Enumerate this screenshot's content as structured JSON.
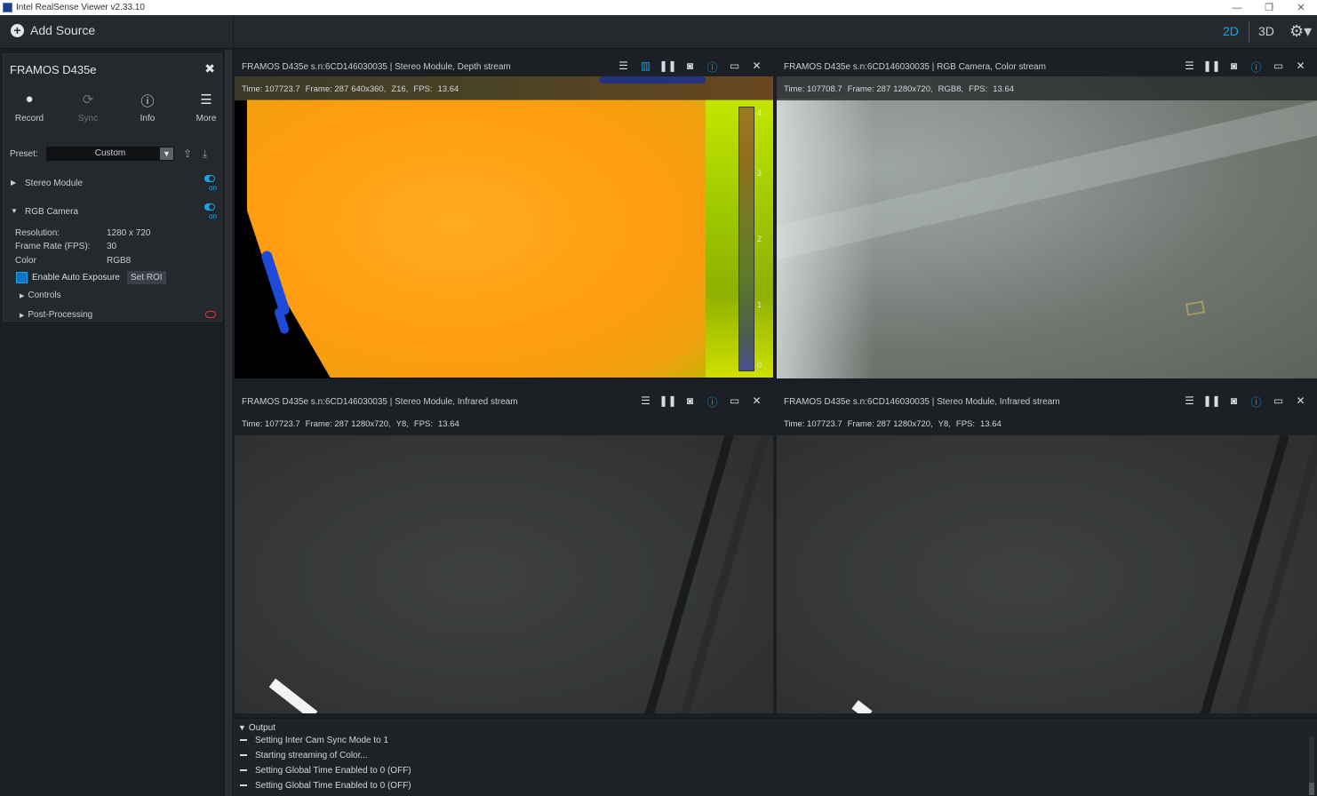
{
  "window": {
    "title": "Intel RealSense Viewer v2.33.10",
    "controls": [
      "—",
      "❐",
      "✕"
    ]
  },
  "topbar": {
    "add_source": "Add Source",
    "view_2d": "2D",
    "view_3d": "3D",
    "settings_icon": "gear-icon"
  },
  "device": {
    "name": "FRAMOS D435e",
    "tools": [
      {
        "label": "Record",
        "icon": "record-icon",
        "enabled": true
      },
      {
        "label": "Sync",
        "icon": "sync-icon",
        "enabled": false
      },
      {
        "label": "Info",
        "icon": "info-icon",
        "enabled": true
      },
      {
        "label": "More",
        "icon": "menu-icon",
        "enabled": true
      }
    ],
    "preset_label": "Preset:",
    "preset_value": "Custom",
    "sensors": [
      {
        "name": "Stereo Module",
        "state": "on",
        "expanded": false
      },
      {
        "name": "RGB Camera",
        "state": "on",
        "expanded": true
      }
    ],
    "rgb_props": [
      {
        "key": "Resolution:",
        "value": "1280 x 720"
      },
      {
        "key": "Frame Rate (FPS):",
        "value": "30"
      },
      {
        "key": "Color",
        "value": "RGB8"
      }
    ],
    "auto_exposure_label": "Enable Auto Exposure",
    "set_roi": "Set ROI",
    "controls": "Controls",
    "post_processing": "Post-Processing"
  },
  "streams": [
    {
      "title": "FRAMOS D435e s.n:6CD146030035 | Stereo Module, Depth stream",
      "time": "Time: 107723.7",
      "frame": "Frame: 287",
      "res": "640x360,",
      "fmt": "Z16,",
      "fps": "FPS:",
      "fps_val": "13.64"
    },
    {
      "title": "FRAMOS D435e s.n:6CD146030035 | RGB Camera, Color stream",
      "time": "Time: 107708.7",
      "frame": "Frame: 287",
      "res": "1280x720,",
      "fmt": "RGB8,",
      "fps": "FPS:",
      "fps_val": "13.64"
    },
    {
      "title": "FRAMOS D435e s.n:6CD146030035 | Stereo Module, Infrared stream",
      "time": "Time: 107723.7",
      "frame": "Frame: 287",
      "res": "1280x720,",
      "fmt": "Y8,",
      "fps": "FPS:",
      "fps_val": "13.64"
    },
    {
      "title": "FRAMOS D435e s.n:6CD146030035 | Stereo Module, Infrared stream",
      "time": "Time: 107723.7",
      "frame": "Frame: 287",
      "res": "1280x720,",
      "fmt": "Y8,",
      "fps": "FPS:",
      "fps_val": "13.64"
    }
  ],
  "depth_colorbar": [
    "4",
    "3",
    "2",
    "1",
    "0"
  ],
  "output": {
    "label": "Output",
    "lines": [
      "Setting Inter Cam Sync Mode to 1",
      "Starting streaming of Color...",
      "Setting Global Time Enabled to 0 (OFF)",
      "Setting Global Time Enabled to 0 (OFF)"
    ]
  },
  "colors": {
    "accent": "#1ba3e8",
    "panel": "#25292e",
    "bg": "#1b1e22",
    "danger": "#e0313f"
  }
}
